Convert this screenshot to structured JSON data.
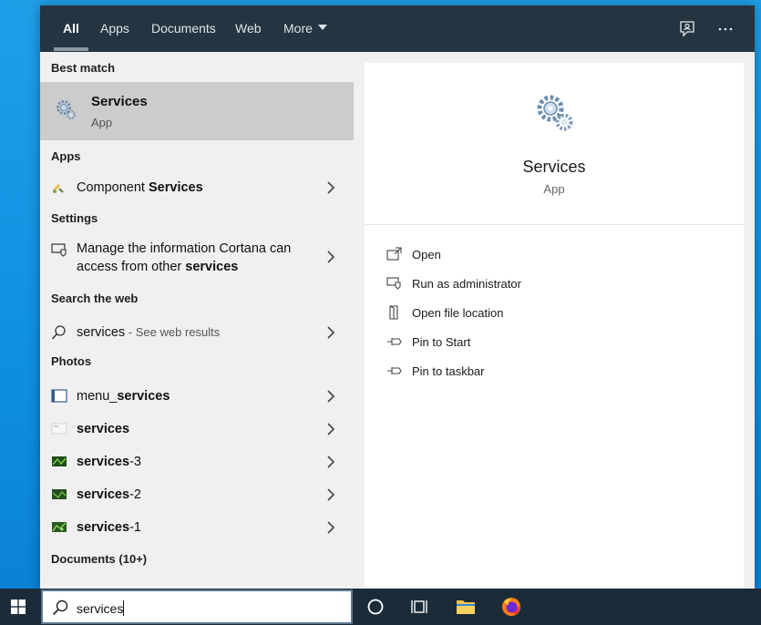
{
  "tabs": [
    {
      "label": "All",
      "active": true
    },
    {
      "label": "Apps"
    },
    {
      "label": "Documents"
    },
    {
      "label": "Web"
    },
    {
      "label": "More"
    }
  ],
  "header_icons": [
    "feedback-icon",
    "more-options-icon"
  ],
  "best_match": {
    "section": "Best match",
    "title": "Services",
    "subtitle": "App",
    "icon": "gears-icon"
  },
  "sections": {
    "apps": "Apps",
    "settings": "Settings",
    "web": "Search the web",
    "photos": "Photos",
    "documents": "Documents (10+)"
  },
  "apps": [
    {
      "pre": "Component ",
      "bold": "Services",
      "icon": "component-services-icon"
    }
  ],
  "settings": [
    {
      "line1": "Manage the information Cortana can",
      "line2_pre": "access from other ",
      "line2_bold": "services",
      "icon": "cortana-settings-icon"
    }
  ],
  "web": [
    {
      "query": "services",
      "hint": " - See web results",
      "icon": "search-icon"
    }
  ],
  "photos": [
    {
      "pre": "menu_",
      "bold": "services",
      "icon": "photo-thumbnail-icon"
    },
    {
      "pre": "",
      "bold": "services",
      "icon": "photo-thumbnail-icon"
    },
    {
      "pre": "",
      "bold": "services",
      "post": "-3",
      "icon": "photo-thumbnail-icon"
    },
    {
      "pre": "",
      "bold": "services",
      "post": "-2",
      "icon": "photo-thumbnail-icon"
    },
    {
      "pre": "",
      "bold": "services",
      "post": "-1",
      "icon": "photo-thumbnail-icon"
    }
  ],
  "preview": {
    "title": "Services",
    "subtitle": "App",
    "actions": [
      {
        "label": "Open",
        "icon": "open-icon"
      },
      {
        "label": "Run as administrator",
        "icon": "shield-icon"
      },
      {
        "label": "Open file location",
        "icon": "file-location-icon"
      },
      {
        "label": "Pin to Start",
        "icon": "pin-icon"
      },
      {
        "label": "Pin to taskbar",
        "icon": "pin-icon"
      }
    ]
  },
  "taskbar": {
    "search_value": "services",
    "icons": [
      "windows-start-icon",
      "cortana-icon",
      "task-view-icon",
      "file-explorer-icon",
      "firefox-icon"
    ]
  },
  "colors": {
    "header_bg": "#243441",
    "pane_bg": "#f0f0f0",
    "selected_bg": "#cccccc",
    "taskbar_bg": "#1c2b38",
    "desktop_blue": "#1f9fe8"
  }
}
